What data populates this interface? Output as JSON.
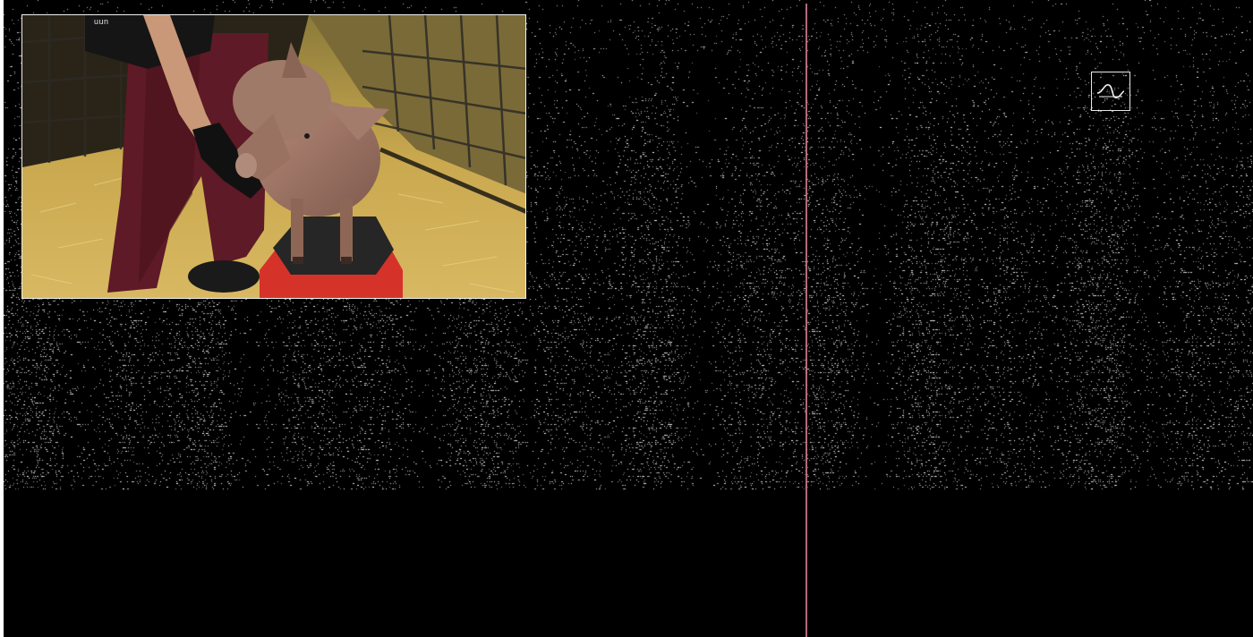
{
  "video": {
    "shirt_text": "uun",
    "subject": "pig-on-stand",
    "icon": "pig-video-frame"
  },
  "logo": {
    "icon": "sine-wave-logo-icon"
  },
  "raster": {
    "icon": "neural-spike-raster"
  },
  "playhead": {
    "color": "#c8748a"
  },
  "colors": {
    "background": "#000000",
    "spikes": "#ffffff",
    "playhead": "#c8748a"
  }
}
